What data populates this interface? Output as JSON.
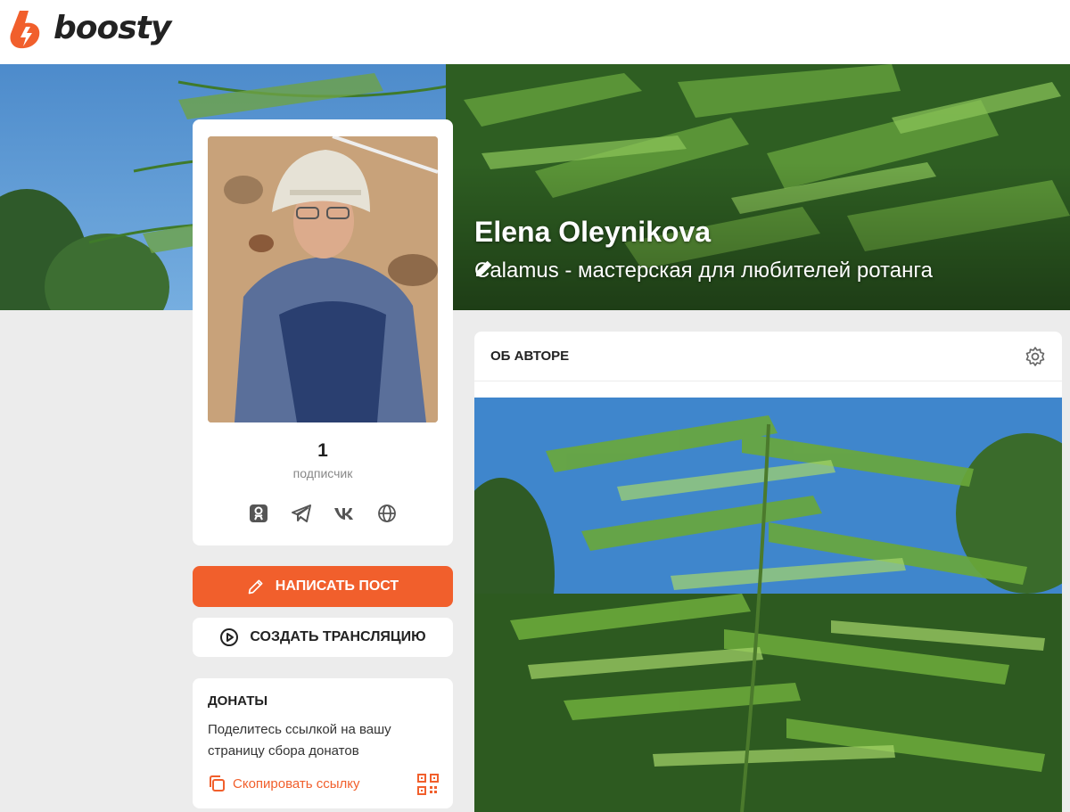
{
  "header": {
    "logo_text": "boosty",
    "logo_icon": "boosty-logo-icon"
  },
  "profile": {
    "name": "Elena Oleynikova",
    "subtitle": "Calamus - мастерская для любителей ротанга",
    "subscribers_count": "1",
    "subscribers_label": "подписчик",
    "socials": [
      "odnoklassniki-icon",
      "telegram-icon",
      "vk-icon",
      "globe-icon"
    ]
  },
  "actions": {
    "write_post": "НАПИСАТЬ ПОСТ",
    "create_stream": "СОЗДАТЬ ТРАНСЛЯЦИЮ"
  },
  "donations": {
    "title": "ДОНАТЫ",
    "text": "Поделитесь ссылкой на вашу страницу сбора донатов",
    "copy_link": "Скопировать ссылку"
  },
  "about": {
    "title": "ОБ АВТОРЕ"
  },
  "colors": {
    "accent": "#f15f2c",
    "background": "#ececec",
    "card": "#ffffff",
    "text": "#222222",
    "muted": "#888888"
  }
}
